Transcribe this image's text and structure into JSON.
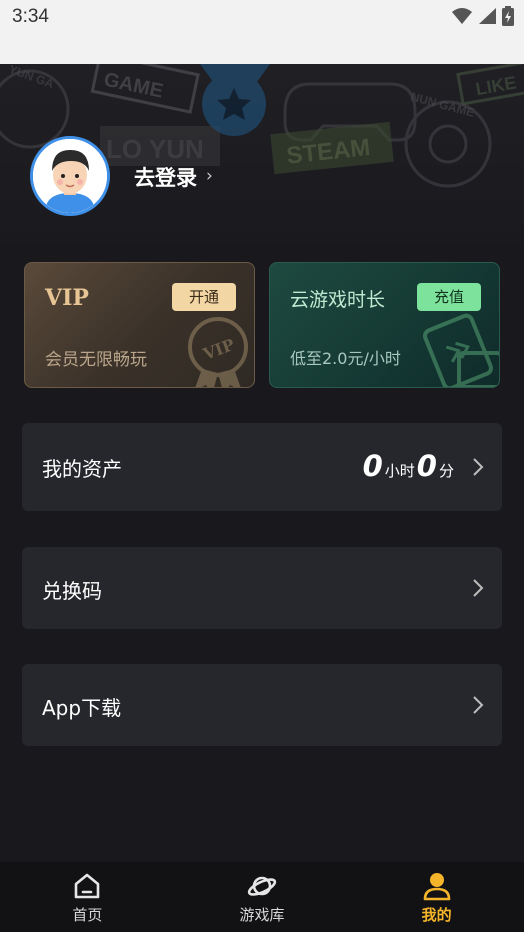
{
  "status_bar": {
    "time": "3:34"
  },
  "hero": {
    "login_label": "去登录",
    "login_chevron": "›",
    "bg_words": [
      "GAME",
      "LO YUN",
      "STEAM",
      "LIKE",
      "YUN GA",
      "NUN GAME"
    ]
  },
  "vip_card": {
    "title": "VIP",
    "button": "开通",
    "subtitle": "会员无限畅玩",
    "badge_text": "VIP"
  },
  "cloud_card": {
    "title": "云游戏时长",
    "button": "充值",
    "subtitle": "低至2.0元/小时"
  },
  "assets_row": {
    "label": "我的资产",
    "hours": "0",
    "hours_unit": "小时",
    "minutes": "0",
    "minutes_unit": "分"
  },
  "redeem_row": {
    "label": "兑换码"
  },
  "app_row": {
    "label": "App下载"
  },
  "tabbar": {
    "items": [
      {
        "label": "首页",
        "icon": "home-icon",
        "active": false
      },
      {
        "label": "游戏库",
        "icon": "planet-icon",
        "active": false
      },
      {
        "label": "我的",
        "icon": "user-icon",
        "active": true
      }
    ]
  },
  "colors": {
    "accent": "#f5b52a",
    "vip_gold": "#e6c494",
    "cloud_green": "#7de29b",
    "avatar_ring": "#3f90e8"
  }
}
